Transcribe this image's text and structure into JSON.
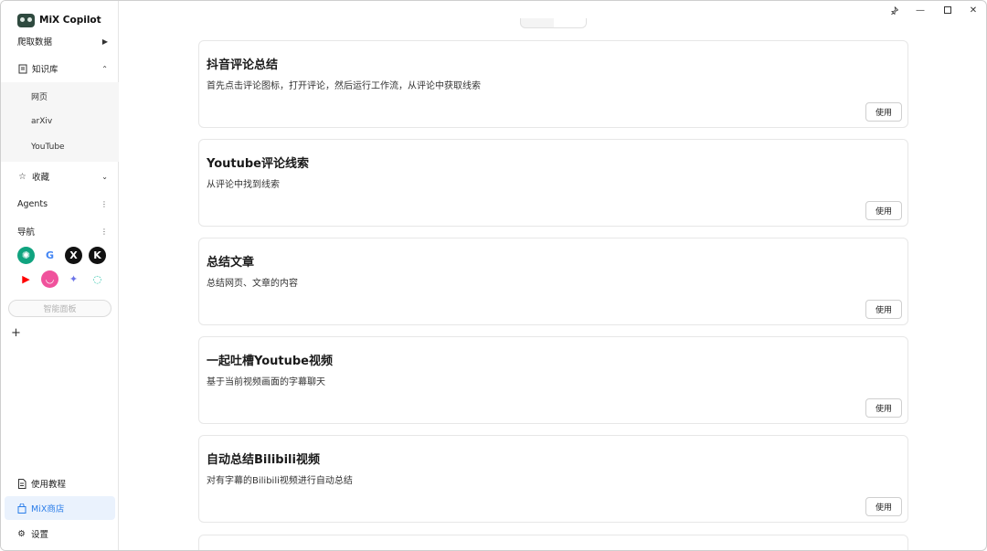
{
  "app": {
    "name": "MiX Copilot"
  },
  "sidebar": {
    "scrape": {
      "label": "爬取数据",
      "icon": "caret-right-icon"
    },
    "knowledge": {
      "label": "知识库",
      "icon": "book-icon",
      "items": [
        {
          "label": "网页"
        },
        {
          "label": "arXiv"
        },
        {
          "label": "YouTube"
        }
      ]
    },
    "favorites": {
      "label": "收藏",
      "icon": "star-icon"
    },
    "agents": {
      "label": "Agents"
    },
    "navigation": {
      "label": "导航",
      "icons": [
        {
          "name": "chatgpt-icon",
          "glyph": "✺",
          "bg": "#10a37f",
          "fg": "#ffffff"
        },
        {
          "name": "google-icon",
          "glyph": "G",
          "bg": "#ffffff",
          "fg": "#4285f4"
        },
        {
          "name": "x-icon",
          "glyph": "X",
          "bg": "#111111",
          "fg": "#ffffff"
        },
        {
          "name": "kimi-icon",
          "glyph": "K",
          "bg": "#111111",
          "fg": "#ffffff"
        },
        {
          "name": "youtube-icon",
          "glyph": "▶",
          "bg": "#ffffff",
          "fg": "#ff0000"
        },
        {
          "name": "poe-icon",
          "glyph": "◡",
          "bg": "#f0529c",
          "fg": "#ffffff"
        },
        {
          "name": "gemini-icon",
          "glyph": "✦",
          "bg": "#ffffff",
          "fg": "#6b74e8"
        },
        {
          "name": "loader-icon",
          "glyph": "◌",
          "bg": "#ffffff",
          "fg": "#20c0a5"
        }
      ]
    },
    "panel_button": "智能面板",
    "plus": "+",
    "tutorial": "使用教程",
    "store": "MiX商店",
    "settings": "设置"
  },
  "cards": [
    {
      "title": "抖音评论总结",
      "desc": "首先点击评论图标，打开评论，然后运行工作流，从评论中获取线索",
      "button": "使用"
    },
    {
      "title": "Youtube评论线索",
      "desc": "从评论中找到线索",
      "button": "使用"
    },
    {
      "title": "总结文章",
      "desc": "总结网页、文章的内容",
      "button": "使用"
    },
    {
      "title": "一起吐槽Youtube视频",
      "desc": "基于当前视频画面的字幕聊天",
      "button": "使用"
    },
    {
      "title": "自动总结Bilibili视频",
      "desc": "对有字幕的Bilibili视频进行自动总结",
      "button": "使用"
    }
  ],
  "colors": {
    "accent": "#2b7de9",
    "active_bg": "#eaf2fd"
  }
}
